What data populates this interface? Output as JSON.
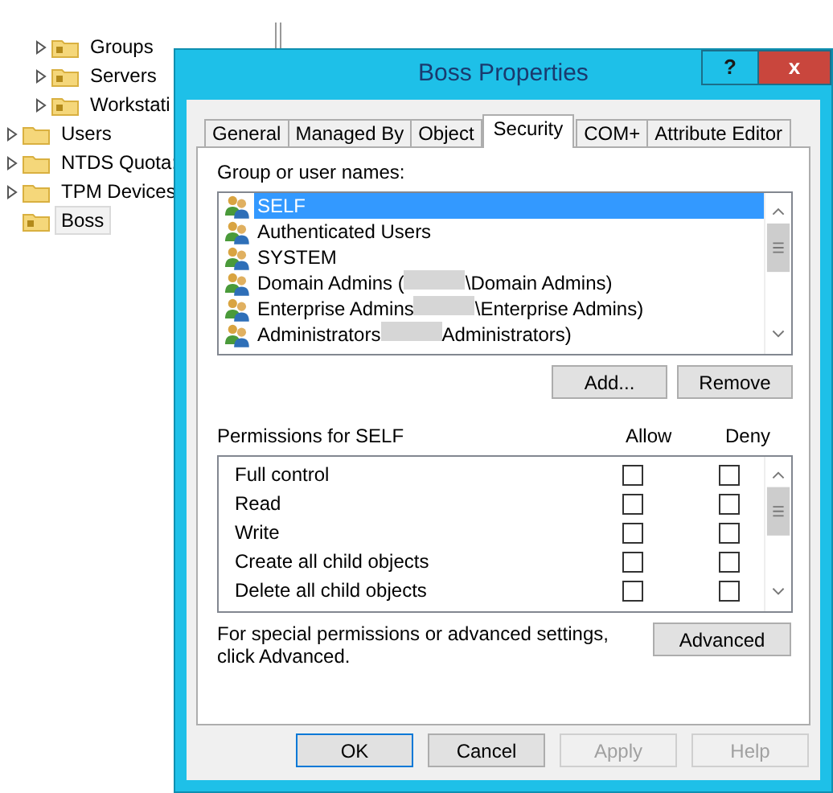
{
  "tree": [
    {
      "children": [
        {
          "label": "Groups",
          "expandable": true,
          "selected": false
        },
        {
          "label": "Servers",
          "expandable": true,
          "selected": false
        },
        {
          "label": "Workstati",
          "expandable": true,
          "selected": false
        }
      ]
    },
    {
      "label": "Users",
      "expandable": true,
      "selected": false
    },
    {
      "label": "NTDS Quota:",
      "expandable": true,
      "selected": false
    },
    {
      "label": "TPM Devices",
      "expandable": true,
      "selected": false
    },
    {
      "label": "Boss",
      "expandable": false,
      "selected": true
    }
  ],
  "dialog": {
    "title": "Boss Properties",
    "help_button": "?",
    "close_button": "x",
    "tabs": [
      {
        "label": "General",
        "selected": false
      },
      {
        "label": "Managed By",
        "selected": false
      },
      {
        "label": "Object",
        "selected": false
      },
      {
        "label": "Security",
        "selected": true
      },
      {
        "label": "COM+",
        "selected": false
      },
      {
        "label": "Attribute Editor",
        "selected": false
      }
    ],
    "group_label": "Group or user names:",
    "principals": [
      {
        "segments": [
          "SELF"
        ],
        "selected": true
      },
      {
        "segments": [
          "Authenticated Users"
        ],
        "selected": false
      },
      {
        "segments": [
          "SYSTEM"
        ],
        "selected": false
      },
      {
        "segments": [
          "Domain Admins (",
          "\\Domain Admins)"
        ],
        "selected": false
      },
      {
        "segments": [
          "Enterprise Admins",
          "\\Enterprise Admins)"
        ],
        "selected": false
      },
      {
        "segments": [
          "Administrators",
          "Administrators)"
        ],
        "selected": false
      }
    ],
    "add_button": "Add...",
    "remove_button": "Remove",
    "permissions_label": "Permissions for SELF",
    "allow_header": "Allow",
    "deny_header": "Deny",
    "permissions": [
      {
        "name": "Full control",
        "allow": false,
        "deny": false
      },
      {
        "name": "Read",
        "allow": false,
        "deny": false
      },
      {
        "name": "Write",
        "allow": false,
        "deny": false
      },
      {
        "name": "Create all child objects",
        "allow": false,
        "deny": false
      },
      {
        "name": "Delete all child objects",
        "allow": false,
        "deny": false
      }
    ],
    "advanced_note": "For special permissions or advanced settings, click Advanced.",
    "advanced_button": "Advanced",
    "buttons": [
      {
        "label": "OK",
        "disabled": false,
        "default": true
      },
      {
        "label": "Cancel",
        "disabled": false,
        "default": false
      },
      {
        "label": "Apply",
        "disabled": true,
        "default": false
      },
      {
        "label": "Help",
        "disabled": true,
        "default": false
      }
    ]
  }
}
